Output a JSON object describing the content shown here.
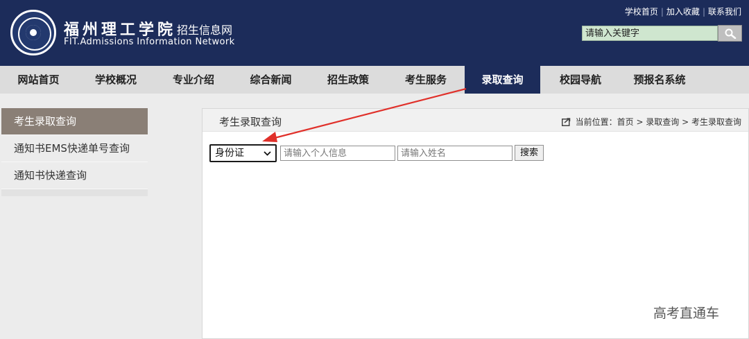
{
  "header": {
    "school_name": "福州理工学院",
    "site_subtitle": "招生信息网",
    "english_name": "FIT.Admissions Information Network",
    "top_links": [
      "学校首页",
      "加入收藏",
      "联系我们"
    ],
    "search_placeholder": "请输入关键字"
  },
  "nav": {
    "items": [
      "网站首页",
      "学校概况",
      "专业介绍",
      "综合新闻",
      "招生政策",
      "考生服务",
      "录取查询",
      "校园导航",
      "预报名系统"
    ],
    "active": "录取查询"
  },
  "sidebar": {
    "items": [
      "考生录取查询",
      "通知书EMS快递单号查询",
      "通知书快递查询"
    ],
    "active": "考生录取查询"
  },
  "panel": {
    "title": "考生录取查询",
    "breadcrumb": "当前位置：首页 > 录取查询 > 考生录取查询",
    "select_value": "身份证",
    "info_placeholder": "请输入个人信息",
    "name_placeholder": "请输入姓名",
    "search_button": "搜索"
  },
  "watermark": "高考直通车",
  "colors": {
    "header_bg": "#1c2c5a",
    "active_tab": "#1c2c5a",
    "sidebar_active": "#8a7f76",
    "annotation_arrow": "#e0302a"
  }
}
